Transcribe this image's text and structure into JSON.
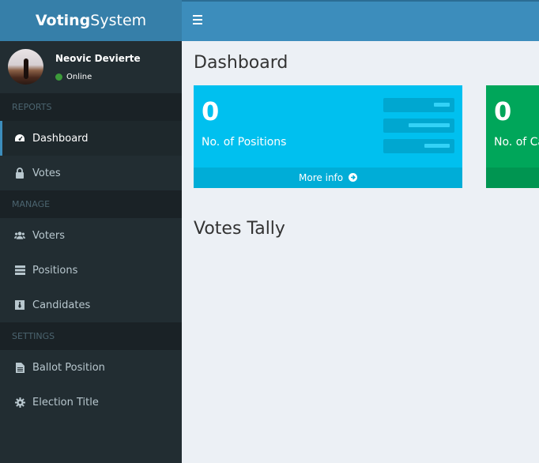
{
  "app": {
    "logo_bold": "Voting",
    "logo_rest": "System"
  },
  "user": {
    "name": "Neovic Devierte",
    "status": "Online"
  },
  "sidebar": {
    "sections": [
      {
        "header": "REPORTS",
        "items": [
          {
            "label": "Dashboard",
            "icon": "dashboard-icon",
            "active": true
          },
          {
            "label": "Votes",
            "icon": "lock-icon"
          }
        ]
      },
      {
        "header": "MANAGE",
        "items": [
          {
            "label": "Voters",
            "icon": "users-icon"
          },
          {
            "label": "Positions",
            "icon": "tasks-icon"
          },
          {
            "label": "Candidates",
            "icon": "black-tie-icon"
          }
        ]
      },
      {
        "header": "SETTINGS",
        "items": [
          {
            "label": "Ballot Position",
            "icon": "file-text-icon"
          },
          {
            "label": "Election Title",
            "icon": "cog-icon"
          }
        ]
      }
    ]
  },
  "main": {
    "title": "Dashboard",
    "boxes": [
      {
        "value": "0",
        "label": "No. of Positions",
        "footer": "More info",
        "color": "#00c0ef"
      },
      {
        "value": "0",
        "label": "No. of Ca",
        "color": "#00a65a"
      }
    ],
    "section_title": "Votes Tally"
  },
  "colors": {
    "header": "#3c8dbc",
    "logo": "#367fa9",
    "sidebar": "#222d32",
    "content": "#ecf0f5"
  }
}
